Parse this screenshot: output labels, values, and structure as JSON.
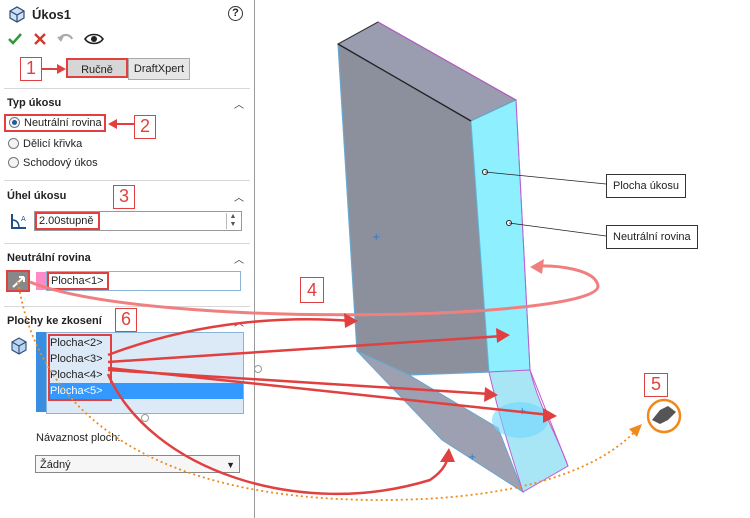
{
  "title": "Úkos1",
  "toolbar": {
    "ok_icon": "checkmark-icon",
    "cancel_icon": "x-icon",
    "undo_icon": "undo-icon",
    "preview_icon": "eye-icon",
    "help_label": "?"
  },
  "tabs": [
    {
      "label": "Ručně",
      "active": true
    },
    {
      "label": "DraftXpert",
      "active": false
    }
  ],
  "typ_ukosu": {
    "heading": "Typ úkosu",
    "options": [
      {
        "label": "Neutrální rovina",
        "selected": true
      },
      {
        "label": "Dělicí křivka",
        "selected": false
      },
      {
        "label": "Schodový úkos",
        "selected": false
      }
    ]
  },
  "uhel_ukosu": {
    "heading": "Úhel úkosu",
    "value": "2.00stupně"
  },
  "neutralni_rovina": {
    "heading": "Neutrální rovina",
    "value": "Plocha<1>"
  },
  "plochy": {
    "heading": "Plochy ke zkosení",
    "items": [
      {
        "label": "Plocha<2>",
        "selected": false
      },
      {
        "label": "Plocha<3>",
        "selected": false
      },
      {
        "label": "Plocha<4>",
        "selected": false
      },
      {
        "label": "Plocha<5>",
        "selected": true
      }
    ],
    "continuity_label": "Návaznost ploch:",
    "continuity_value": "Žádný"
  },
  "callouts": {
    "plocha_ukosu": "Plocha úkosu",
    "neutralni_rovina": "Neutrální rovina"
  },
  "step_numbers": [
    "1",
    "2",
    "3",
    "4",
    "5",
    "6"
  ],
  "colors": {
    "annotation_red": "#e0403f",
    "orange": "#f08a1c",
    "face_cyan": "#8ef0ff",
    "face_grey": "#8f929f"
  }
}
